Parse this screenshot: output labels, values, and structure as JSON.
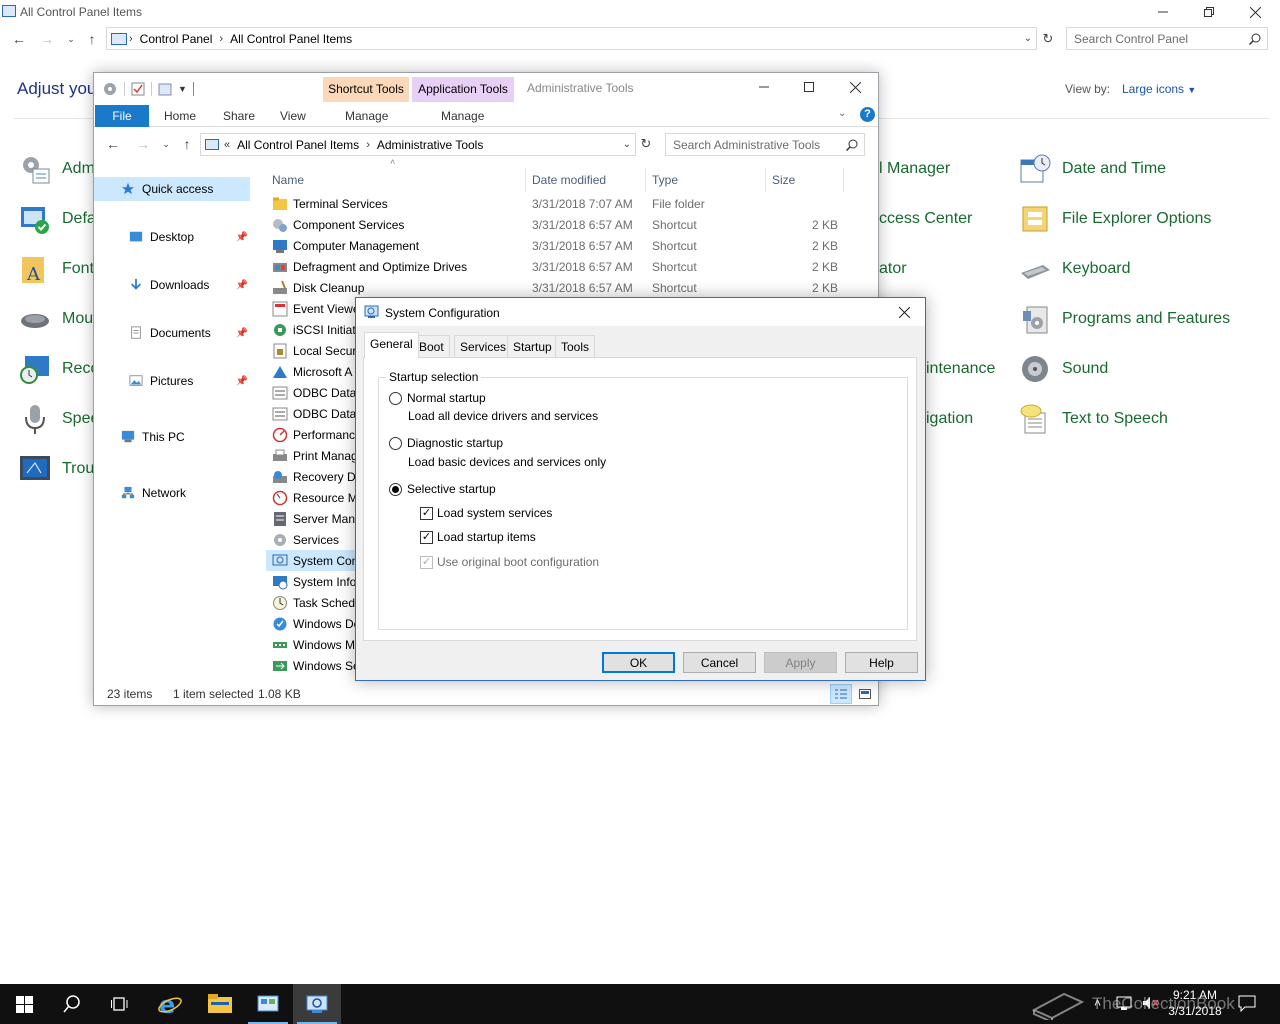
{
  "control_panel": {
    "window_title": "All Control Panel Items",
    "breadcrumb": [
      "Control Panel",
      "All Control Panel Items"
    ],
    "search_placeholder": "Search Control Panel",
    "heading": "Adjust you",
    "view_by_label": "View by:",
    "view_by_value": "Large icons",
    "items_left": [
      "Adm",
      "Defa",
      "Font",
      "Mou",
      "Reco",
      "Spee",
      "Trou"
    ],
    "items_middle": [
      "l Manager",
      "ccess Center",
      "ator",
      "",
      "intenance",
      "igation"
    ],
    "items_right": [
      "Date and Time",
      "File Explorer Options",
      "Keyboard",
      "Programs and Features",
      "Sound",
      "Text to Speech"
    ]
  },
  "explorer": {
    "title": "Administrative Tools",
    "context_tabs": [
      {
        "group": "Shortcut Tools",
        "tab": "Manage",
        "color": "#fbd9b8"
      },
      {
        "group": "Application Tools",
        "tab": "Manage",
        "color": "#e8cff6"
      }
    ],
    "ribbon_tabs": [
      "File",
      "Home",
      "Share",
      "View"
    ],
    "breadcrumb": [
      "All Control Panel Items",
      "Administrative Tools"
    ],
    "breadcrumb_overflow": "«",
    "search_placeholder": "Search Administrative Tools",
    "nav": [
      {
        "label": "Quick access",
        "icon": "star-icon",
        "selected": true,
        "pinned": false
      },
      {
        "label": "Desktop",
        "icon": "desktop-folder-icon",
        "selected": false,
        "pinned": true
      },
      {
        "label": "Downloads",
        "icon": "downloads-icon",
        "selected": false,
        "pinned": true
      },
      {
        "label": "Documents",
        "icon": "documents-icon",
        "selected": false,
        "pinned": true
      },
      {
        "label": "Pictures",
        "icon": "pictures-icon",
        "selected": false,
        "pinned": true
      },
      {
        "label": "This PC",
        "icon": "computer-icon",
        "selected": false,
        "pinned": false
      },
      {
        "label": "Network",
        "icon": "network-icon",
        "selected": false,
        "pinned": false
      }
    ],
    "columns": {
      "name": "Name",
      "date": "Date modified",
      "type": "Type",
      "size": "Size"
    },
    "files": [
      {
        "name": "Terminal Services",
        "date": "3/31/2018 7:07 AM",
        "type": "File folder",
        "size": "",
        "icon": "folder-icon"
      },
      {
        "name": "Component Services",
        "date": "3/31/2018 6:57 AM",
        "type": "Shortcut",
        "size": "2 KB",
        "icon": "component-services-icon"
      },
      {
        "name": "Computer Management",
        "date": "3/31/2018 6:57 AM",
        "type": "Shortcut",
        "size": "2 KB",
        "icon": "computer-management-icon"
      },
      {
        "name": "Defragment and Optimize Drives",
        "date": "3/31/2018 6:57 AM",
        "type": "Shortcut",
        "size": "2 KB",
        "icon": "defrag-icon"
      },
      {
        "name": "Disk Cleanup",
        "date": "3/31/2018 6:57 AM",
        "type": "Shortcut",
        "size": "2 KB",
        "icon": "disk-cleanup-icon"
      },
      {
        "name": "Event Viewe",
        "date": "",
        "type": "",
        "size": "",
        "icon": "event-viewer-icon"
      },
      {
        "name": "iSCSI Initiato",
        "date": "",
        "type": "",
        "size": "",
        "icon": "iscsi-icon"
      },
      {
        "name": "Local Securi",
        "date": "",
        "type": "",
        "size": "",
        "icon": "local-security-icon"
      },
      {
        "name": "Microsoft A",
        "date": "",
        "type": "",
        "size": "",
        "icon": "azure-icon"
      },
      {
        "name": "ODBC Data",
        "date": "",
        "type": "",
        "size": "",
        "icon": "odbc-icon"
      },
      {
        "name": "ODBC Data",
        "date": "",
        "type": "",
        "size": "",
        "icon": "odbc-icon"
      },
      {
        "name": "Performanc",
        "date": "",
        "type": "",
        "size": "",
        "icon": "performance-icon"
      },
      {
        "name": "Print Manag",
        "date": "",
        "type": "",
        "size": "",
        "icon": "printer-icon"
      },
      {
        "name": "Recovery Dr",
        "date": "",
        "type": "",
        "size": "",
        "icon": "recovery-drive-icon"
      },
      {
        "name": "Resource M",
        "date": "",
        "type": "",
        "size": "",
        "icon": "resource-monitor-icon"
      },
      {
        "name": "Server Mana",
        "date": "",
        "type": "",
        "size": "",
        "icon": "server-manager-icon"
      },
      {
        "name": "Services",
        "date": "",
        "type": "",
        "size": "",
        "icon": "services-icon"
      },
      {
        "name": "System Con",
        "date": "",
        "type": "",
        "size": "",
        "icon": "system-config-icon",
        "selected": true
      },
      {
        "name": "System Info",
        "date": "",
        "type": "",
        "size": "",
        "icon": "system-info-icon"
      },
      {
        "name": "Task Schedu",
        "date": "",
        "type": "",
        "size": "",
        "icon": "task-scheduler-icon"
      },
      {
        "name": "Windows De",
        "date": "",
        "type": "",
        "size": "",
        "icon": "windows-defender-icon"
      },
      {
        "name": "Windows M",
        "date": "",
        "type": "",
        "size": "",
        "icon": "memory-diagnostic-icon"
      },
      {
        "name": "Windows Se",
        "date": "",
        "type": "",
        "size": "",
        "icon": "windows-server-backup-icon"
      }
    ],
    "status": {
      "count": "23 items",
      "selection": "1 item selected",
      "size": "1.08 KB"
    }
  },
  "msconfig": {
    "title": "System Configuration",
    "tabs": [
      "General",
      "Boot",
      "Services",
      "Startup",
      "Tools"
    ],
    "active_tab": "General",
    "group_title": "Startup selection",
    "options": [
      {
        "label": "Normal startup",
        "description": "Load all device drivers and services",
        "selected": false
      },
      {
        "label": "Diagnostic startup",
        "description": "Load basic devices and services only",
        "selected": false
      },
      {
        "label": "Selective startup",
        "description": "",
        "selected": true
      }
    ],
    "checkboxes": [
      {
        "label": "Load system services",
        "checked": true,
        "enabled": true
      },
      {
        "label": "Load startup items",
        "checked": true,
        "enabled": true
      },
      {
        "label": "Use original boot configuration",
        "checked": true,
        "enabled": false
      }
    ],
    "buttons": {
      "ok": "OK",
      "cancel": "Cancel",
      "apply": "Apply",
      "help": "Help"
    }
  },
  "taskbar": {
    "time": "9:21 AM",
    "date": "3/31/2018",
    "watermark": "TheCollectionBook",
    "accent": "#76b9ed"
  }
}
